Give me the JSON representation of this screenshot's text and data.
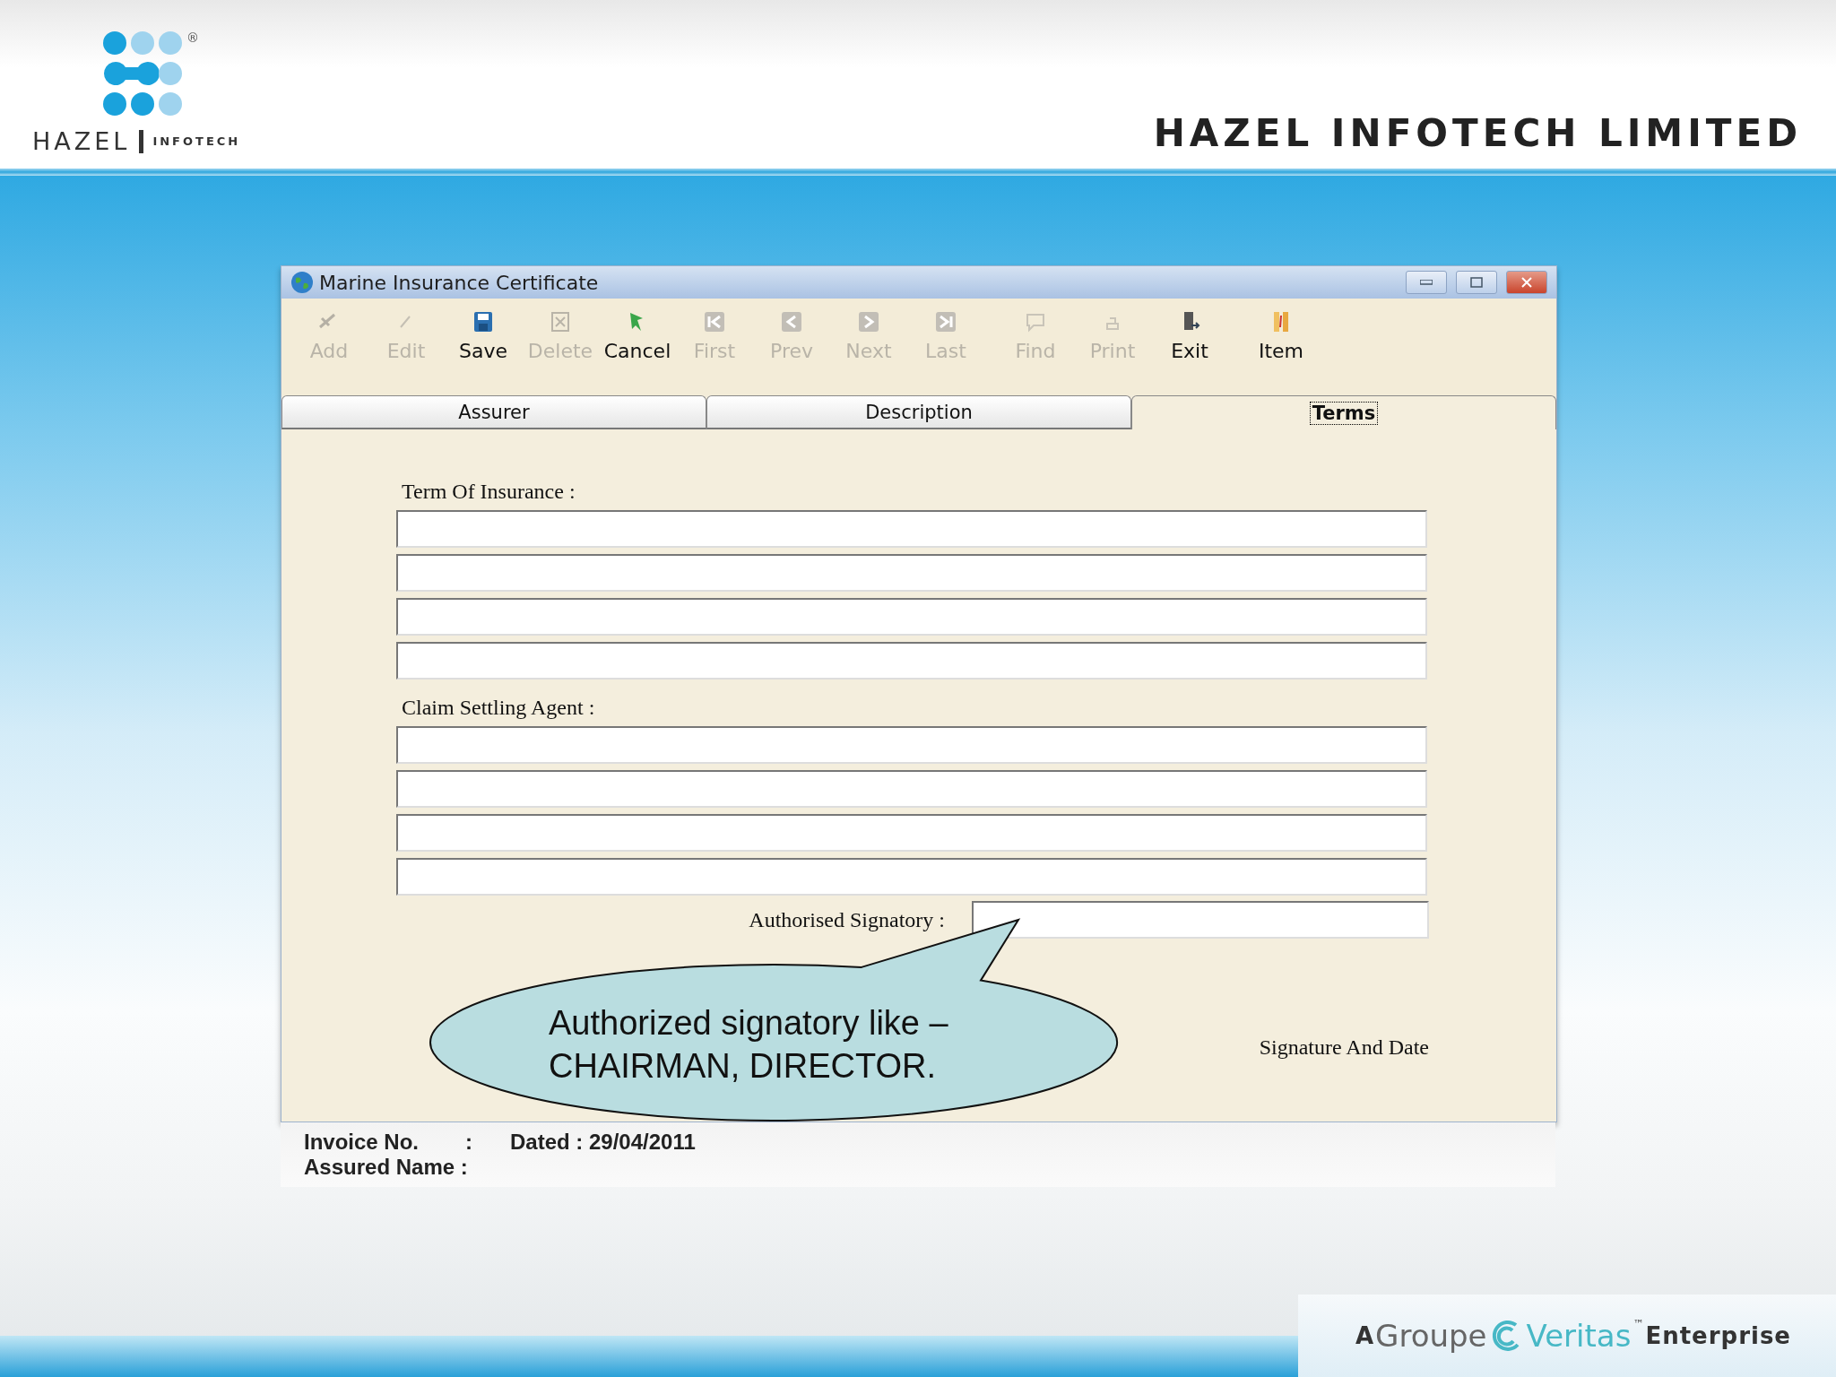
{
  "header": {
    "logo_word": "HAZEL",
    "logo_subword": "INFOTECH",
    "registered_mark": "®",
    "company": "HAZEL INFOTECH LIMITED"
  },
  "window": {
    "title": "Marine Insurance Certificate"
  },
  "toolbar": [
    {
      "label": "Add",
      "disabled": true
    },
    {
      "label": "Edit",
      "disabled": true
    },
    {
      "label": "Save",
      "disabled": false
    },
    {
      "label": "Delete",
      "disabled": true
    },
    {
      "label": "Cancel",
      "disabled": false
    },
    {
      "label": "First",
      "disabled": true
    },
    {
      "label": "Prev",
      "disabled": true
    },
    {
      "label": "Next",
      "disabled": true
    },
    {
      "label": "Last",
      "disabled": true
    },
    {
      "label": "Find",
      "disabled": true
    },
    {
      "label": "Print",
      "disabled": true
    },
    {
      "label": "Exit",
      "disabled": false
    },
    {
      "label": "Item",
      "disabled": false
    }
  ],
  "tabs": [
    {
      "label": "Assurer",
      "selected": false
    },
    {
      "label": "Description",
      "selected": false
    },
    {
      "label": "Terms",
      "selected": true
    }
  ],
  "form": {
    "term_label": "Term Of Insurance :",
    "claim_label": "Claim Settling Agent :",
    "signatory_label": "Authorised Signatory :",
    "signature_caption": "Signature And Date"
  },
  "callout": {
    "lines": [
      "Authorized signatory like –",
      "CHAIRMAN, DIRECTOR."
    ]
  },
  "status_bar": {
    "invoice_label": "Invoice No.",
    "invoice_colon": ":",
    "dated": "Dated : 29/04/2011",
    "assured_label": "Assured Name :"
  },
  "footer": {
    "prefix": "A",
    "groupe": "Groupe",
    "brand": "Veritas",
    "tm": "™",
    "suffix": "Enterprise"
  }
}
